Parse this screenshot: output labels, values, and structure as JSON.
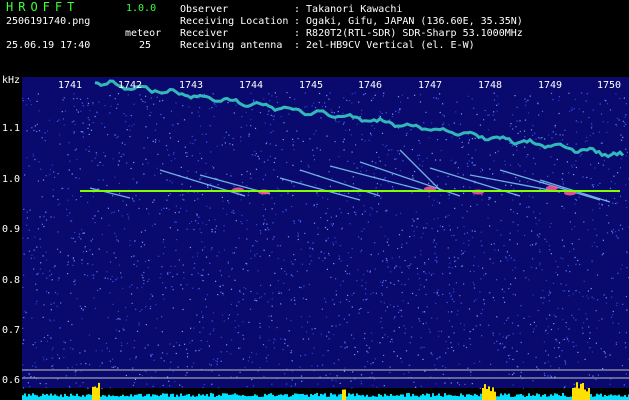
{
  "app": {
    "title": "HROFFT",
    "version": "1.0.0"
  },
  "file": {
    "name": "2506191740.png",
    "datetime": "25.06.19 17:40"
  },
  "meteor": {
    "label": "meteor",
    "count": "25"
  },
  "info": [
    {
      "label": "Observer",
      "value": ": Takanori Kawachi"
    },
    {
      "label": "Receiving Location",
      "value": ": Ogaki, Gifu, JAPAN (136.60E, 35.35N)"
    },
    {
      "label": "Receiver",
      "value": ": R820T2(RTL-SDR) SDR-Sharp 53.1000MHz"
    },
    {
      "label": "Receiving antenna",
      "value": ": 2el-HB9CV Vertical (el. E-W)"
    }
  ],
  "axis": {
    "unit": "kHz",
    "x_ticks": [
      "1741",
      "1742",
      "1743",
      "1744",
      "1745",
      "1746",
      "1747",
      "1748",
      "1749",
      "1750"
    ],
    "y_ticks": [
      "1.1",
      "1.0",
      "0.9",
      "0.8",
      "0.7",
      "0.6"
    ]
  },
  "colors": {
    "background": "#0a0a6e",
    "accent_green": "#3cff3c",
    "carrier": "#7fff00",
    "level_bar": "#00e0ff",
    "level_peak": "#ffe000"
  }
}
